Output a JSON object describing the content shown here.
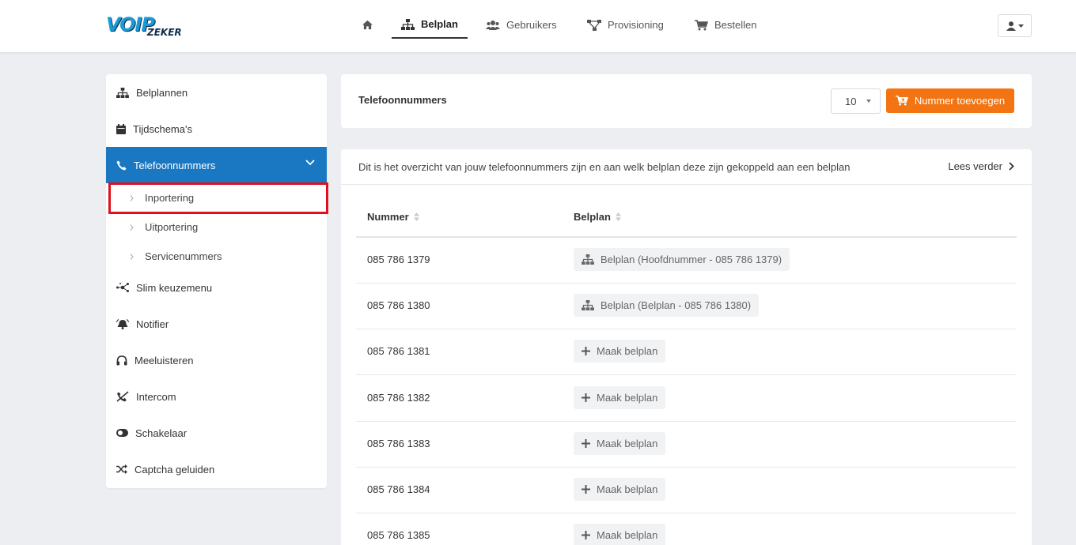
{
  "app": {
    "logo_text": "VOIP",
    "logo_sub": "ZEKER"
  },
  "nav": {
    "home_icon": "home-icon",
    "items": [
      {
        "label": "Belplan",
        "icon": "sitemap-icon",
        "active": true
      },
      {
        "label": "Gebruikers",
        "icon": "users-icon"
      },
      {
        "label": "Provisioning",
        "icon": "network-icon"
      },
      {
        "label": "Bestellen",
        "icon": "cart-icon"
      }
    ],
    "user_icon": "user-icon"
  },
  "sidebar": {
    "items": [
      {
        "label": "Belplannen",
        "icon": "sitemap-icon"
      },
      {
        "label": "Tijdschema's",
        "icon": "calendar-icon"
      },
      {
        "label": "Telefoonnummers",
        "icon": "phone-icon",
        "active": true
      },
      {
        "label": "Slim keuzemenu",
        "icon": "nodes-icon"
      },
      {
        "label": "Notifier",
        "icon": "bell-icon"
      },
      {
        "label": "Meeluisteren",
        "icon": "headphones-icon"
      },
      {
        "label": "Intercom",
        "icon": "phone-slash-icon"
      },
      {
        "label": "Schakelaar",
        "icon": "toggle-icon"
      },
      {
        "label": "Captcha geluiden",
        "icon": "shuffle-icon"
      }
    ],
    "subitems": [
      {
        "label": "Inportering"
      },
      {
        "label": "Uitportering"
      },
      {
        "label": "Servicenummers"
      }
    ]
  },
  "header": {
    "title": "Telefoonnummers",
    "page_size": "10",
    "add_button": "Nummer toevoegen"
  },
  "table": {
    "info": "Dit is het overzicht van jouw telefoonnummers zijn en aan welk belplan deze zijn gekoppeld aan een belplan",
    "read_more": "Lees verder",
    "columns": [
      "Nummer",
      "Belplan"
    ],
    "rows": [
      {
        "number": "085 786 1379",
        "belplan": "Belplan (Hoofdnummer - 085 786 1379)",
        "type": "linked"
      },
      {
        "number": "085 786 1380",
        "belplan": "Belplan (Belplan - 085 786 1380)",
        "type": "linked"
      },
      {
        "number": "085 786 1381",
        "belplan": "Maak belplan",
        "type": "create"
      },
      {
        "number": "085 786 1382",
        "belplan": "Maak belplan",
        "type": "create"
      },
      {
        "number": "085 786 1383",
        "belplan": "Maak belplan",
        "type": "create"
      },
      {
        "number": "085 786 1384",
        "belplan": "Maak belplan",
        "type": "create"
      },
      {
        "number": "085 786 1385",
        "belplan": "Maak belplan",
        "type": "create"
      }
    ]
  },
  "colors": {
    "accent_blue": "#1a78c2",
    "orange": "#f27412",
    "highlight_red": "#e0101e"
  }
}
